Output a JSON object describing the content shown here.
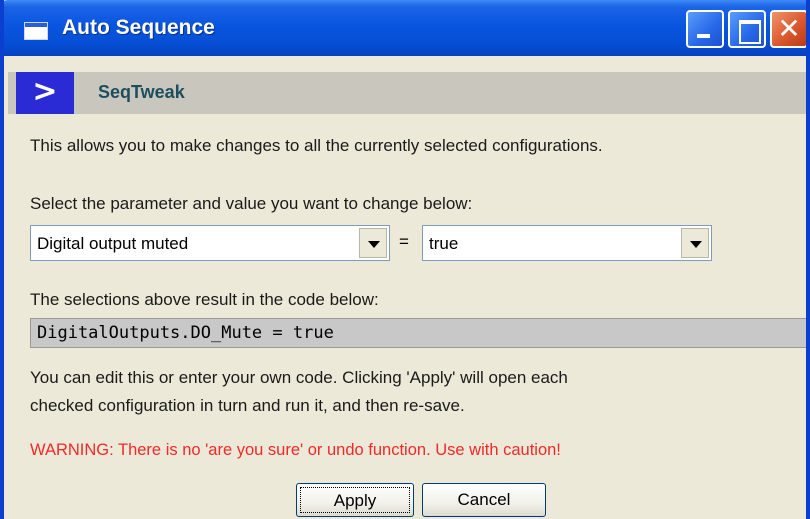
{
  "window": {
    "title": "Auto Sequence"
  },
  "header": {
    "arrow": ">",
    "label": "SeqTweak"
  },
  "content": {
    "intro": "This allows you to make changes to all the currently selected configurations.",
    "select_prompt": "Select the parameter and value you want to change below:",
    "parameter_select": {
      "value": "Digital output muted"
    },
    "equals": "=",
    "value_select": {
      "value": "true"
    },
    "result_prompt": "The selections above result in the code below:",
    "code": "DigitalOutputs.DO_Mute = true",
    "edit_note_line1": "You can edit this or enter your own code. Clicking 'Apply' will open each",
    "edit_note_line2": "checked configuration in turn and run it, and then re-save.",
    "warning": "WARNING: There is no 'are you sure' or undo function.  Use with caution!"
  },
  "buttons": {
    "apply": "Apply",
    "cancel": "Cancel"
  },
  "colors": {
    "titlebar": "#0a55e0",
    "header_arrow_bg": "#2b2bd6",
    "warning": "#ee2a2a"
  },
  "icons": {
    "app": "window-icon",
    "minimize": "minimize-icon",
    "maximize": "maximize-icon",
    "close": "close-icon",
    "dropdown": "chevron-down-icon"
  }
}
